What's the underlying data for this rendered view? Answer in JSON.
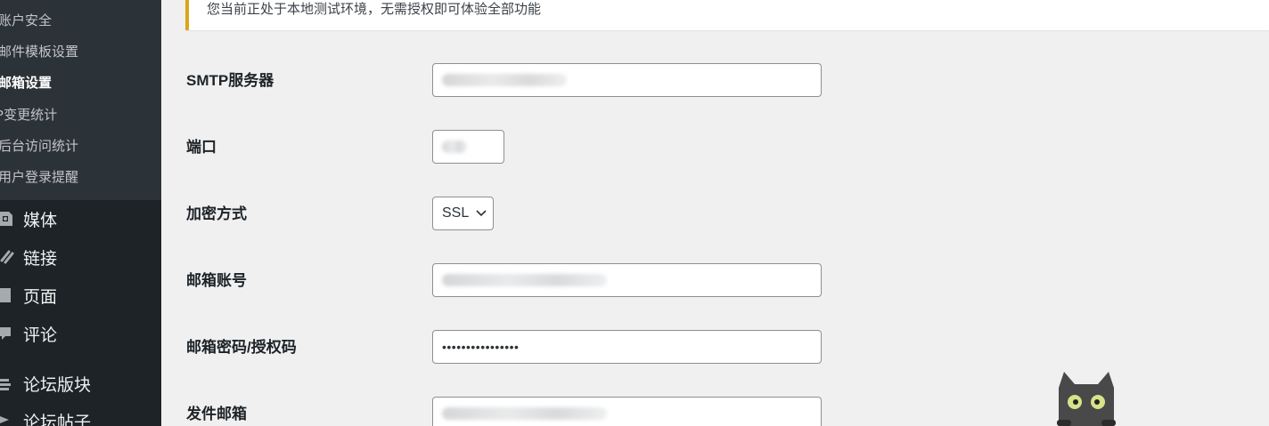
{
  "sidebar": {
    "submenu": [
      {
        "label": "账户安全",
        "active": false
      },
      {
        "label": "邮件模板设置",
        "active": false
      },
      {
        "label": "邮箱设置",
        "active": true
      },
      {
        "label": "IP变更统计",
        "active": false
      },
      {
        "label": "后台访问统计",
        "active": false
      },
      {
        "label": "用户登录提醒",
        "active": false
      }
    ],
    "menu": [
      {
        "label": "媒体",
        "icon": "media-icon"
      },
      {
        "label": "链接",
        "icon": "link-icon"
      },
      {
        "label": "页面",
        "icon": "page-icon"
      },
      {
        "label": "评论",
        "icon": "comment-icon"
      },
      {
        "label": "论坛版块",
        "icon": "forum-icon"
      },
      {
        "label": "论坛帖子",
        "icon": "topic-icon"
      }
    ]
  },
  "notice": {
    "text": "您当前正处于本地测试环境，无需授权即可体验全部功能",
    "accent": "#dba617"
  },
  "form": {
    "smtp_server": {
      "label": "SMTP服务器",
      "value": ""
    },
    "port": {
      "label": "端口",
      "value": ""
    },
    "encryption": {
      "label": "加密方式",
      "value": "SSL"
    },
    "account": {
      "label": "邮箱账号",
      "value": ""
    },
    "password": {
      "label": "邮箱密码/授权码",
      "value": "••••••••••••••••"
    },
    "sender": {
      "label": "发件邮箱",
      "value": ""
    }
  },
  "colors": {
    "sidebar_bg": "#1d2327",
    "submenu_bg": "#2c3338",
    "page_bg": "#f0f0f1"
  }
}
